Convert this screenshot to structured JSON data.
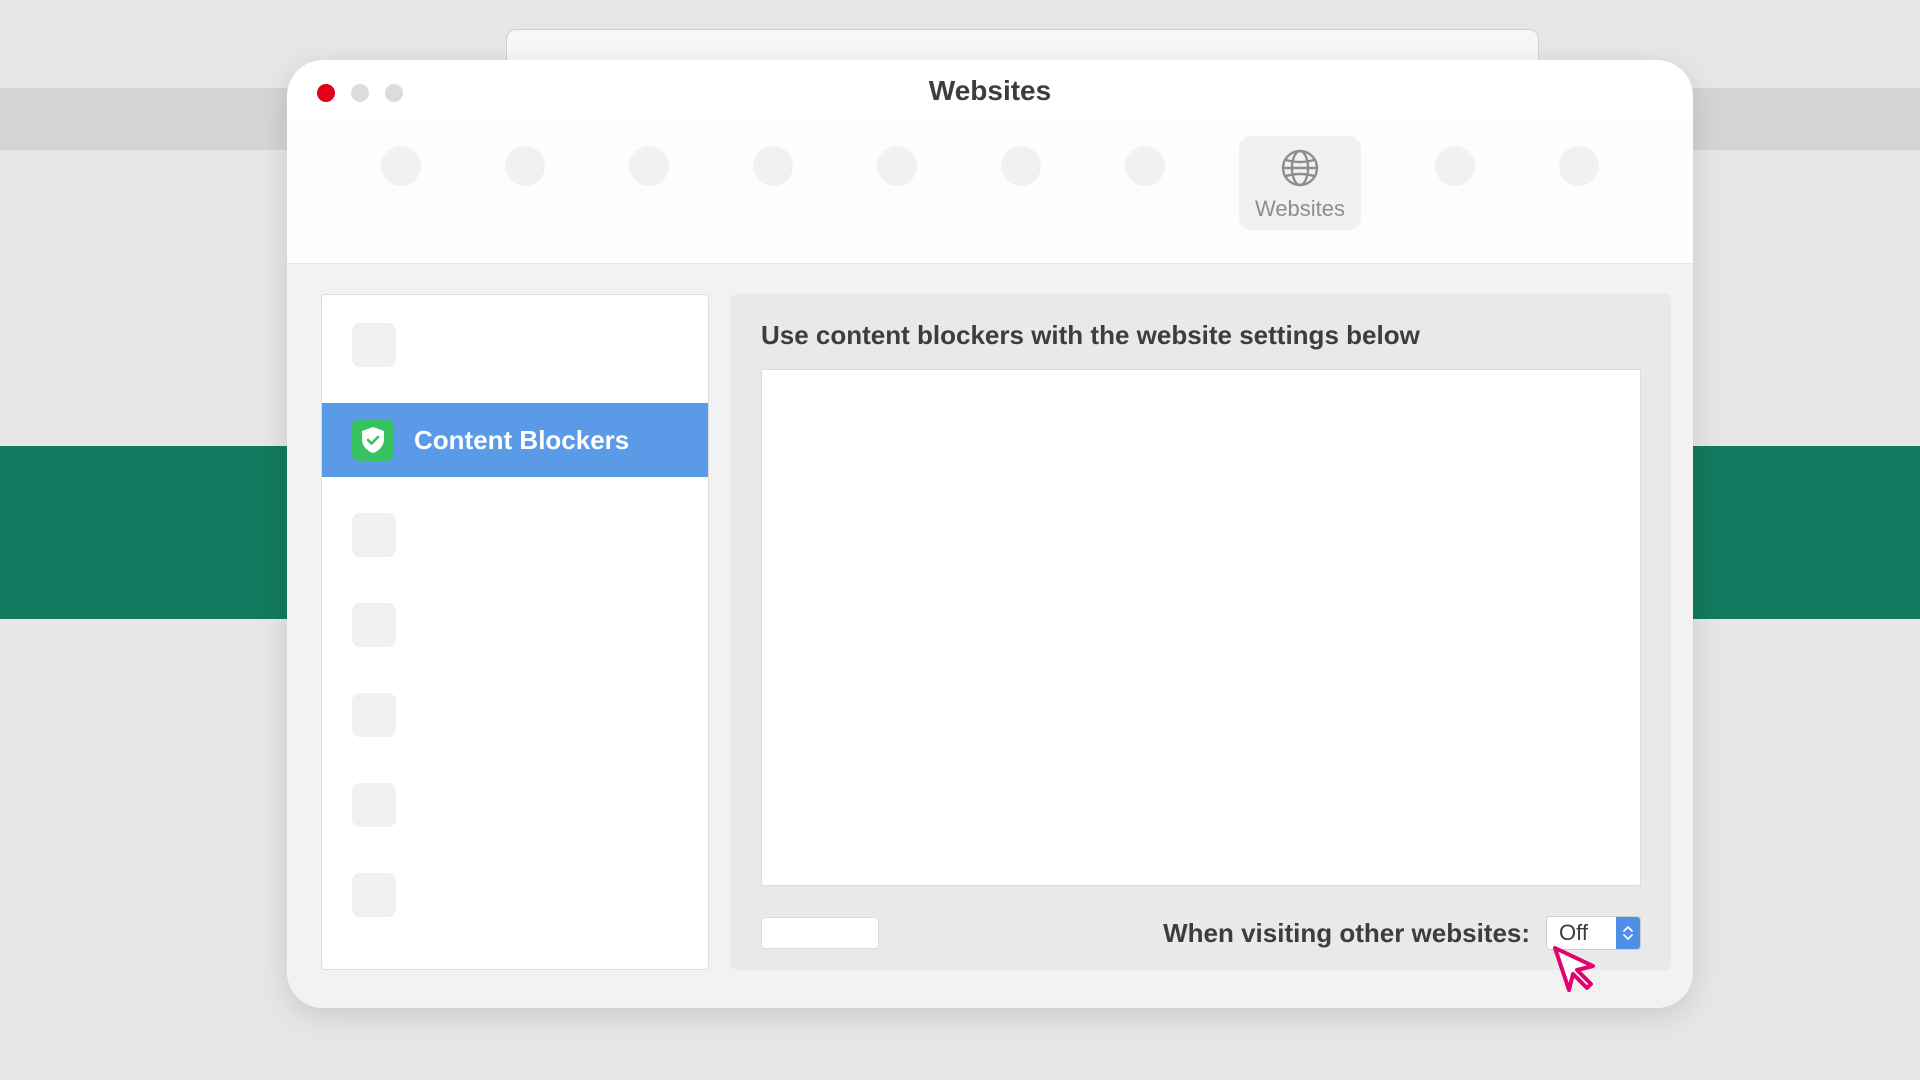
{
  "window": {
    "title": "Websites"
  },
  "toolbar": {
    "activeTab": {
      "label": "Websites"
    }
  },
  "sidebar": {
    "selected": {
      "label": "Content Blockers"
    }
  },
  "panel": {
    "heading": "Use content blockers with the website settings below",
    "dropdownLabel": "When visiting other websites:",
    "dropdownValue": "Off"
  }
}
